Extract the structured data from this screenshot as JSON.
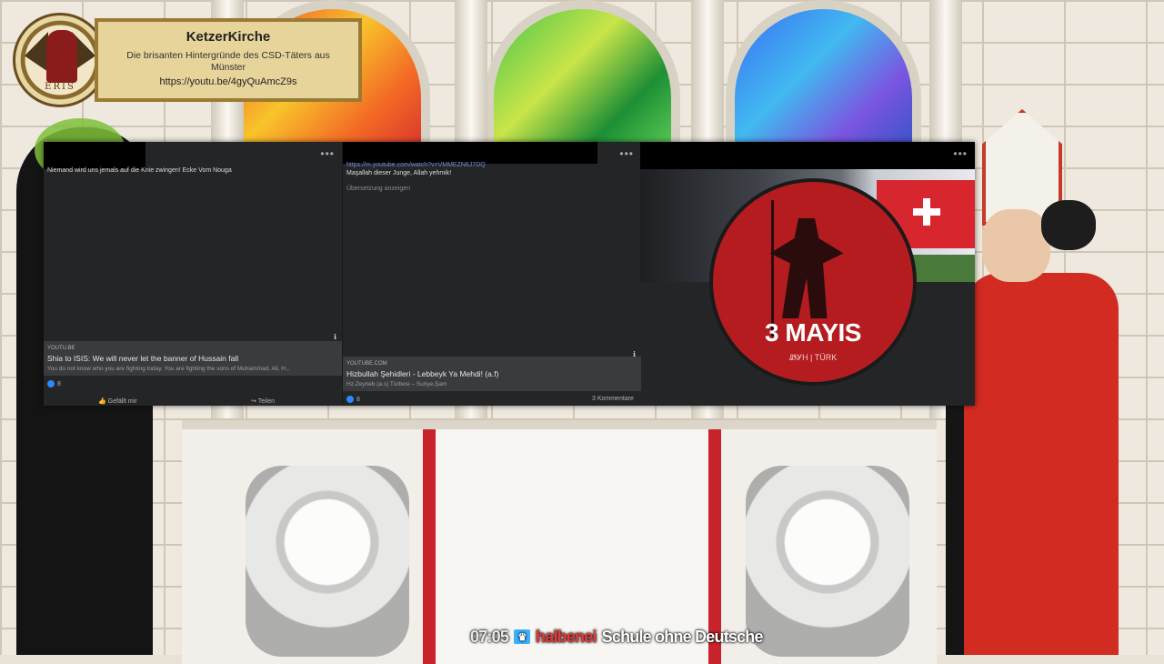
{
  "banner": {
    "logo_text": "ERIS",
    "title": "KetzerKirche",
    "subtitle": "Die brisanten Hintergründe des CSD-Täters aus Münster",
    "url": "https://youtu.be/4gyQuAmcZ9s"
  },
  "posts": [
    {
      "text": "Niemand wird uns jemals auf die Knie zwingen! Ecke Vom Nouga",
      "card": {
        "source": "YOUTU.BE",
        "title": "Shia to ISIS: We will never let the banner of Hussain fall",
        "description": "You do not know who you are fighting today. You are fighting the sons of Muhammad, Ali, H..."
      },
      "reactions": "8",
      "actions": [
        "Gefällt mir",
        "Teilen"
      ]
    },
    {
      "link": "https://m.youtube.com/watch?v=VMMEZN6J7DQ",
      "text": "Maşallah dieser Junge, Allah yehmik!",
      "translate": "Übersetzung anzeigen",
      "card": {
        "source": "YOUTUBE.COM",
        "title": "Hizbullah Şehidleri - Lebbeyk Ya Mehdi! (a.f)",
        "description": "Hz.Zeyneb (a.s) Türbesi – Suriye,Şam"
      },
      "reactions": "8",
      "comments": "3 Kommentare"
    },
    {
      "badge_title": "3 MAYIS",
      "badge_sub": "ᏪᎽᎻ | TÜRK"
    }
  ],
  "ticker": {
    "time": "07:05",
    "user": "halbenei",
    "message": "Schule ohne Deutsche"
  },
  "colors": {
    "ticker_user": "#e63838",
    "facebook_bg": "#242526",
    "badge_red": "#b51c20"
  }
}
